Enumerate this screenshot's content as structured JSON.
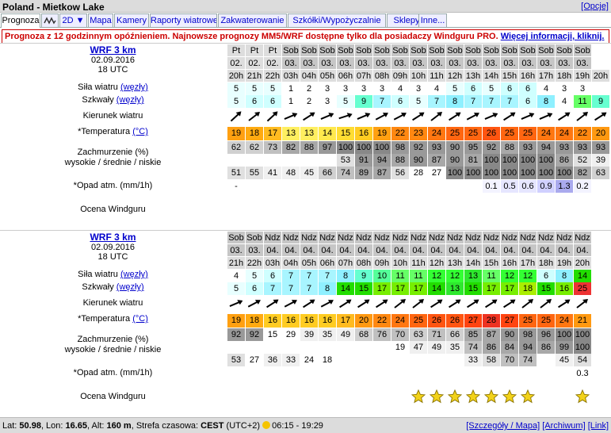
{
  "header": {
    "title": "Poland - Mietkow Lake",
    "options_label": "[Opcje]"
  },
  "tabs": [
    {
      "label": "Prognoza",
      "active": true
    },
    {
      "label": "",
      "icon": "graph-icon"
    },
    {
      "label": "2D ▼"
    },
    {
      "label": "Mapa"
    },
    {
      "label": "Kamery"
    },
    {
      "label": "Raporty wiatrowe"
    },
    {
      "label": "Zakwaterowanie"
    },
    {
      "label": "Szkółki/Wypożyczalnie"
    },
    {
      "label": "Sklepy"
    },
    {
      "label": "Inne..."
    }
  ],
  "warning": {
    "text": "Prognoza z 12 godzinnym opóźnieniem. Najnowsze prognozy MM5/WRF dostępne tylko dla posiadaczy Windguru PRO. ",
    "link": "Więcej informacji, kliknij."
  },
  "labels": {
    "wind": "Siła wiatru",
    "wind_unit": "(węzły)",
    "gust": "Szkwały",
    "gust_unit": "(węzły)",
    "dir": "Kierunek wiatru",
    "temp": "*Temperatura",
    "temp_unit": "(°C)",
    "cloud1": "Zachmurzenie (%)",
    "cloud2": "wysokie / średnie / niskie",
    "precip": "*Opad atm. (mm/1h)",
    "rating": "Ocena Windguru"
  },
  "blocks": [
    {
      "model": "WRF 3 km",
      "date": "02.09.2016",
      "time": "18 UTC",
      "days": [
        "Pt",
        "Pt",
        "Pt",
        "Sob",
        "Sob",
        "Sob",
        "Sob",
        "Sob",
        "Sob",
        "Sob",
        "Sob",
        "Sob",
        "Sob",
        "Sob",
        "Sob",
        "Sob",
        "Sob",
        "Sob",
        "Sob",
        "Sob"
      ],
      "dates": [
        "02.",
        "02.",
        "02.",
        "03.",
        "03.",
        "03.",
        "03.",
        "03.",
        "03.",
        "03.",
        "03.",
        "03.",
        "03.",
        "03.",
        "03.",
        "03.",
        "03.",
        "03.",
        "03.",
        "03."
      ],
      "hours": [
        "20h",
        "21h",
        "22h",
        "03h",
        "04h",
        "05h",
        "06h",
        "07h",
        "08h",
        "09h",
        "10h",
        "11h",
        "12h",
        "13h",
        "14h",
        "15h",
        "16h",
        "17h",
        "18h",
        "19h",
        "20h"
      ],
      "wind": [
        5,
        5,
        5,
        1,
        2,
        3,
        3,
        3,
        3,
        4,
        3,
        4,
        5,
        6,
        5,
        6,
        6,
        4,
        3,
        3
      ],
      "gust": [
        5,
        6,
        6,
        1,
        2,
        3,
        5,
        9,
        7,
        6,
        5,
        7,
        8,
        7,
        7,
        7,
        6,
        8,
        4,
        11,
        9
      ],
      "dir": [
        40,
        45,
        40,
        60,
        50,
        60,
        65,
        60,
        55,
        55,
        50,
        45,
        50,
        55,
        60,
        50,
        60,
        60,
        50,
        45,
        50
      ],
      "temp": [
        19,
        18,
        17,
        13,
        13,
        14,
        15,
        16,
        19,
        22,
        23,
        24,
        25,
        25,
        26,
        25,
        25,
        24,
        24,
        22,
        20
      ],
      "cloud_hi": [
        62,
        62,
        73,
        82,
        88,
        97,
        100,
        100,
        100,
        98,
        92,
        93,
        90,
        95,
        92,
        88,
        93,
        94,
        93,
        93,
        93
      ],
      "cloud_mid": [
        "",
        "",
        "",
        "",
        "",
        "",
        53,
        91,
        94,
        88,
        90,
        87,
        90,
        81,
        100,
        100,
        100,
        100,
        86,
        52,
        39
      ],
      "cloud_lo": [
        51,
        55,
        41,
        48,
        45,
        66,
        74,
        89,
        87,
        56,
        28,
        27,
        100,
        100,
        100,
        100,
        100,
        100,
        100,
        82,
        63
      ],
      "precip": [
        "-",
        "",
        "",
        "",
        "",
        "",
        "",
        "",
        "",
        "",
        "",
        "",
        "",
        "",
        0.1,
        0.5,
        0.6,
        0.9,
        1.3,
        0.2,
        ""
      ],
      "stars": []
    },
    {
      "model": "WRF 3 km",
      "date": "02.09.2016",
      "time": "18 UTC",
      "days": [
        "Sob",
        "Sob",
        "Ndz",
        "Ndz",
        "Ndz",
        "Ndz",
        "Ndz",
        "Ndz",
        "Ndz",
        "Ndz",
        "Ndz",
        "Ndz",
        "Ndz",
        "Ndz",
        "Ndz",
        "Ndz",
        "Ndz",
        "Ndz",
        "Ndz",
        "Ndz"
      ],
      "dates": [
        "03.",
        "03.",
        "04.",
        "04.",
        "04.",
        "04.",
        "04.",
        "04.",
        "04.",
        "04.",
        "04.",
        "04.",
        "04.",
        "04.",
        "04.",
        "04.",
        "04.",
        "04.",
        "04.",
        "04."
      ],
      "hours": [
        "21h",
        "22h",
        "03h",
        "04h",
        "05h",
        "06h",
        "07h",
        "08h",
        "09h",
        "10h",
        "11h",
        "12h",
        "13h",
        "14h",
        "15h",
        "16h",
        "17h",
        "18h",
        "19h",
        "20h"
      ],
      "wind": [
        4,
        5,
        6,
        7,
        7,
        7,
        8,
        9,
        10,
        11,
        11,
        12,
        12,
        13,
        11,
        12,
        12,
        6,
        8,
        14
      ],
      "gust": [
        5,
        6,
        7,
        7,
        7,
        8,
        14,
        15,
        17,
        17,
        17,
        14,
        13,
        15,
        17,
        17,
        18,
        15,
        16,
        25
      ],
      "dir": [
        60,
        55,
        50,
        55,
        50,
        55,
        50,
        50,
        50,
        45,
        45,
        50,
        50,
        50,
        50,
        50,
        45,
        45,
        50,
        45
      ],
      "temp": [
        19,
        18,
        16,
        16,
        16,
        16,
        17,
        20,
        22,
        24,
        25,
        26,
        26,
        27,
        28,
        27,
        25,
        25,
        24,
        21
      ],
      "cloud_hi": [
        92,
        92,
        15,
        29,
        39,
        35,
        49,
        68,
        76,
        70,
        63,
        71,
        66,
        85,
        87,
        90,
        98,
        96,
        100,
        100
      ],
      "cloud_mid": [
        "",
        "",
        "",
        "",
        "",
        "",
        "",
        "",
        "",
        19,
        47,
        49,
        35,
        74,
        86,
        84,
        94,
        86,
        99,
        100
      ],
      "cloud_lo": [
        53,
        27,
        36,
        33,
        24,
        18,
        "",
        "",
        "",
        "",
        "",
        "",
        "",
        33,
        58,
        70,
        74,
        "",
        45,
        54
      ],
      "precip": [
        "",
        "",
        "",
        "",
        "",
        "",
        "",
        "",
        "",
        "",
        "",
        "",
        "",
        "",
        "",
        "",
        "",
        "",
        "",
        "0.3"
      ],
      "stars": [
        10,
        11,
        12,
        13,
        14,
        15,
        16,
        19
      ]
    }
  ],
  "footer": {
    "left": "Lat: ",
    "lat": "50.98",
    "lon_l": ", Lon: ",
    "lon": "16.65",
    "alt_l": ", Alt: ",
    "alt": "160 m",
    "tz_l": ", Strefa czasowa: ",
    "tz": "CEST",
    "tz_off": " (UTC+2) ",
    "sun": "06:15 - 19:29",
    "links": [
      "[Szczegóły / Mapa]",
      "[Archiwum]",
      "[Link]"
    ]
  }
}
